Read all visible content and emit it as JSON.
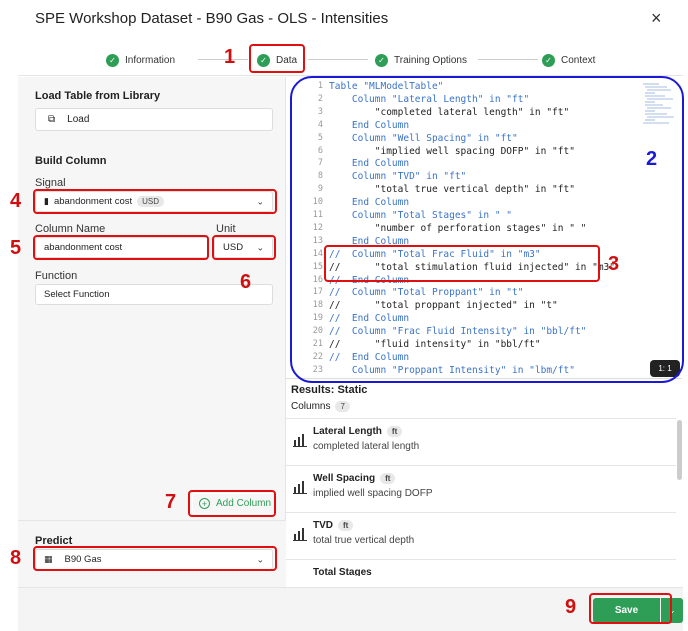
{
  "window": {
    "title": "SPE Workshop Dataset - B90 Gas - OLS - Intensities",
    "close": "×"
  },
  "steps": [
    {
      "label": "Information"
    },
    {
      "label": "Data"
    },
    {
      "label": "Training Options"
    },
    {
      "label": "Context"
    }
  ],
  "left": {
    "load_heading": "Load Table from Library",
    "load_button": "Load",
    "build_heading": "Build Column",
    "signal_label": "Signal",
    "signal_value": "abandonment cost",
    "signal_unit": "USD",
    "colname_label": "Column Name",
    "colname_value": "abandonment cost",
    "unit_label": "Unit",
    "unit_value": "USD",
    "function_label": "Function",
    "function_value": "Select Function",
    "add_column": "Add Column",
    "predict_label": "Predict",
    "predict_value": "B90 Gas"
  },
  "editor": {
    "lines": [
      {
        "n": "1",
        "t": "Table \"MLModelTable\""
      },
      {
        "n": "2",
        "t": "    Column \"Lateral Length\" in \"ft\""
      },
      {
        "n": "3",
        "t": "        \"completed lateral length\" in \"ft\""
      },
      {
        "n": "4",
        "t": "    End Column"
      },
      {
        "n": "5",
        "t": "    Column \"Well Spacing\" in \"ft\""
      },
      {
        "n": "6",
        "t": "        \"implied well spacing DOFP\" in \"ft\""
      },
      {
        "n": "7",
        "t": "    End Column"
      },
      {
        "n": "8",
        "t": "    Column \"TVD\" in \"ft\""
      },
      {
        "n": "9",
        "t": "        \"total true vertical depth\" in \"ft\""
      },
      {
        "n": "10",
        "t": "    End Column"
      },
      {
        "n": "11",
        "t": "    Column \"Total Stages\" in \" \""
      },
      {
        "n": "12",
        "t": "        \"number of perforation stages\" in \" \""
      },
      {
        "n": "13",
        "t": "    End Column"
      },
      {
        "n": "14",
        "t": "//  Column \"Total Frac Fluid\" in \"m3\""
      },
      {
        "n": "15",
        "t": "//      \"total stimulation fluid injected\" in \"m3\""
      },
      {
        "n": "16",
        "t": "//  End Column"
      },
      {
        "n": "17",
        "t": "//  Column \"Total Proppant\" in \"t\""
      },
      {
        "n": "18",
        "t": "//      \"total proppant injected\" in \"t\""
      },
      {
        "n": "19",
        "t": "//  End Column"
      },
      {
        "n": "20",
        "t": "//  Column \"Frac Fluid Intensity\" in \"bbl/ft\""
      },
      {
        "n": "21",
        "t": "//      \"fluid intensity\" in \"bbl/ft\""
      },
      {
        "n": "22",
        "t": "//  End Column"
      },
      {
        "n": "23",
        "t": "    Column \"Proppant Intensity\" in \"lbm/ft\""
      }
    ],
    "cursor_pos": "1: 1"
  },
  "results": {
    "title": "Results: Static",
    "columns_label": "Columns",
    "columns_count": "7",
    "items": [
      {
        "name": "Lateral Length",
        "unit": "ft",
        "desc": "completed lateral length"
      },
      {
        "name": "Well Spacing",
        "unit": "ft",
        "desc": "implied well spacing DOFP"
      },
      {
        "name": "TVD",
        "unit": "ft",
        "desc": "total true vertical depth"
      },
      {
        "name": "Total Stages",
        "unit": "",
        "desc": ""
      }
    ]
  },
  "footer": {
    "save": "Save"
  },
  "annotations": [
    "1",
    "2",
    "3",
    "4",
    "5",
    "6",
    "7",
    "8",
    "9"
  ],
  "colors": {
    "accent": "#2e9e57",
    "annotation_red": "#e01010",
    "annotation_blue": "#1a1ad6"
  }
}
